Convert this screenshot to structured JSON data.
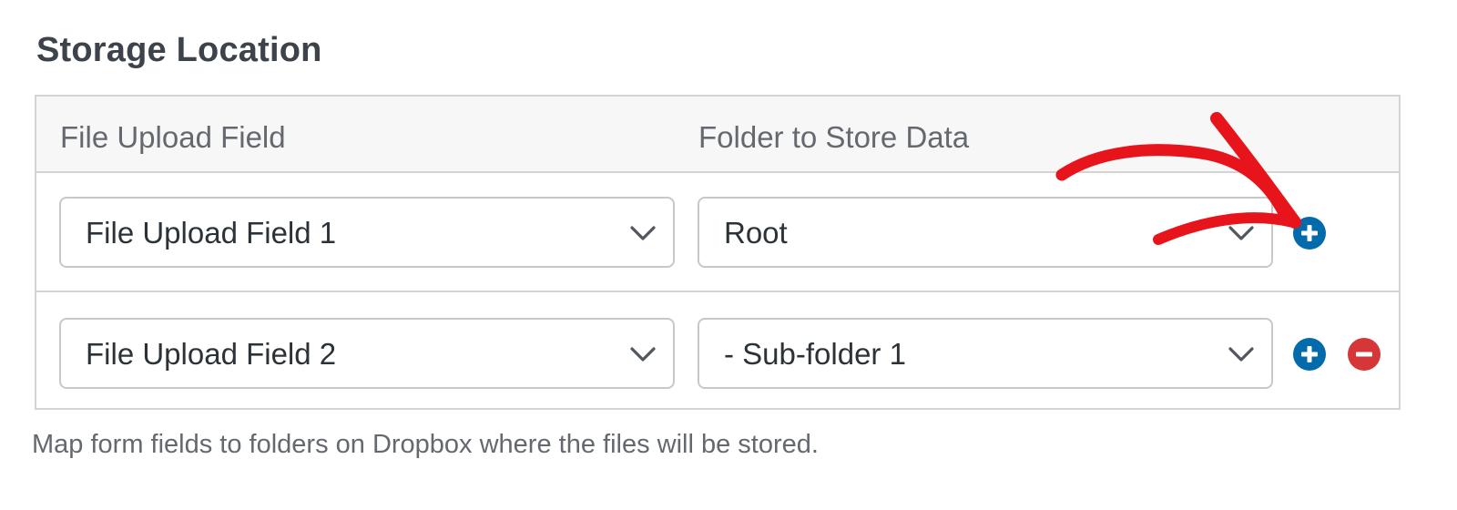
{
  "section": {
    "title": "Storage Location"
  },
  "table": {
    "headers": {
      "file_field": "File Upload Field",
      "folder": "Folder to Store Data"
    },
    "rows": [
      {
        "file_field": "File Upload Field 1",
        "folder": "Root",
        "actions": [
          "add"
        ]
      },
      {
        "file_field": "File Upload Field 2",
        "folder": "- Sub-folder 1",
        "actions": [
          "add",
          "remove"
        ]
      }
    ]
  },
  "help_text": "Map form fields to folders on Dropbox where the files will be stored.",
  "icons": {
    "select_arrow": "chevron-down-icon",
    "add": "plus-circle-icon",
    "remove": "minus-circle-icon",
    "annotation": "red-arrow-annotation"
  },
  "colors": {
    "add_button": "#036aab",
    "remove_button": "#d63638",
    "annotation": "#e8141c",
    "header_bg": "#f7f7f7",
    "border": "#d4d4d4"
  }
}
